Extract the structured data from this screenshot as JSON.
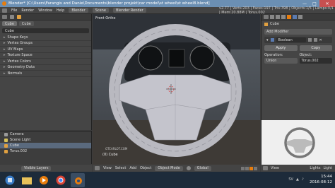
{
  "window": {
    "title": "Blender* [C:\\Users\\Farangis and Danie\\Documents\\blender projekt\\car model\\st wheel\\st wheel8.blend]",
    "minimize": "—",
    "maximize": "□",
    "close": "✕"
  },
  "info_header": {
    "menu": [
      "File",
      "Render",
      "Window",
      "Help"
    ],
    "layout": "Blender",
    "scene": "Scene",
    "engine": "Blender Render",
    "stats": "v2.77 | Verts:203 | Faces:197 | Tris:398 | Objects:1/5 | Lamps:0/1 | Mem:20.88M | Torus.002"
  },
  "left_panel": {
    "tabs": [
      "Cube",
      "Cube"
    ],
    "name_value": "Cube",
    "sections": [
      "Shape Keys",
      "Vertex Groups",
      "UV Maps",
      "Texture Space",
      "Vertex Colors",
      "Geometry Data",
      "Normals"
    ]
  },
  "outliner": {
    "rows": [
      {
        "label": "Camera",
        "color": "#9a9a9a"
      },
      {
        "label": "Scene Light",
        "color": "#d6c15a"
      },
      {
        "label": "Cube",
        "color": "#e0a040"
      },
      {
        "label": "Torus.002",
        "color": "#e0a040"
      }
    ],
    "selected_index": 2
  },
  "viewport": {
    "view_label": "Front Ortho",
    "object_label": "(0) Cube",
    "watermark": "GTCARLOT.COM"
  },
  "viewport_header": {
    "items": [
      "View",
      "Select",
      "Add",
      "Object",
      "Object Mode",
      "Global"
    ]
  },
  "properties": {
    "object_name": "Cube",
    "add_modifier": "Add Modifier",
    "modifier_name": "Boolean",
    "apply": "Apply",
    "copy": "Copy",
    "operation_label": "Operation:",
    "object_label": "Object:",
    "operation_value": "Union",
    "object_value": "Torus.002"
  },
  "prop_footer": {
    "items": [
      "View",
      "Lights",
      "Light"
    ]
  },
  "bottom_left": {
    "label": "Visible Layers"
  },
  "taskbar": {
    "clock_time": "15:44",
    "clock_date": "2016-08-12",
    "lang": "SV"
  },
  "colors": {
    "accent": "#e87d0d",
    "wheel": "#b9b9c0",
    "selection": "#5a6a7e"
  }
}
